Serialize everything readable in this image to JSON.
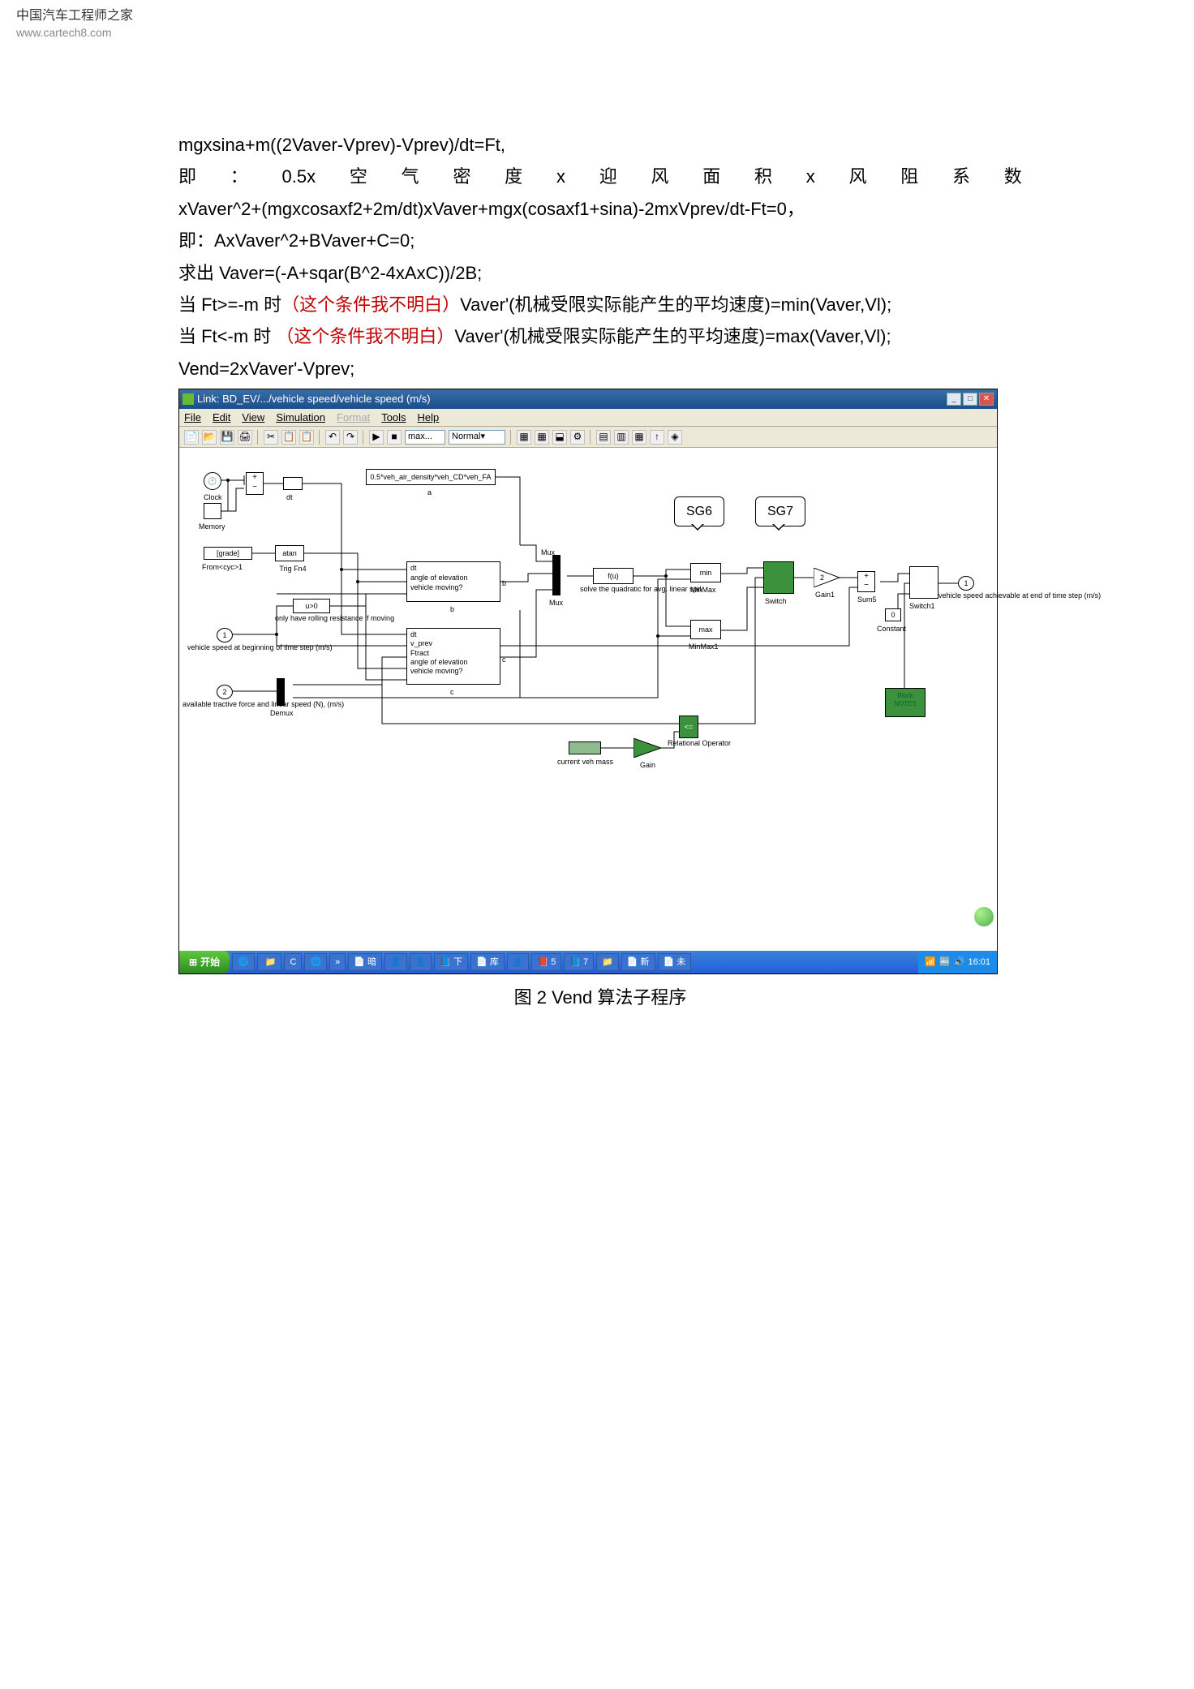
{
  "watermark": {
    "line1": "中国汽车工程师之家",
    "line2": "www.cartech8.com"
  },
  "text": {
    "l1": "mgxsina+m((2Vaver-Vprev)-Vprev)/dt=Ft,",
    "l2_parts": [
      "即",
      "：",
      "0.5x",
      "空",
      "气",
      "密",
      "度",
      "x",
      "迎",
      "风",
      "面",
      "积",
      "x",
      "风",
      "阻",
      "系",
      "数"
    ],
    "l3": "xVaver^2+(mgxcosaxf2+2m/dt)xVaver+mgx(cosaxf1+sina)-2mxVprev/dt-Ft=0，",
    "l4": "即：AxVaver^2+BVaver+C=0;",
    "l5": "求出 Vaver=(-A+sqar(B^2-4xAxC))/2B;",
    "l6a": "当 Ft>=-m 时",
    "l6b": "（这个条件我不明白）",
    "l6c": "Vaver'(机械受限实际能产生的平均速度)=min(Vaver,Vl);",
    "l7a": "当 Ft<-m 时 ",
    "l7b": "（这个条件我不明白）",
    "l7c": "Vaver'(机械受限实际能产生的平均速度)=max(Vaver,Vl);",
    "l8": "Vend=2xVaver'-Vprev;"
  },
  "simulink": {
    "title": "Link: BD_EV/.../vehicle speed/vehicle speed (m/s)",
    "menu": {
      "file": "File",
      "edit": "Edit",
      "view": "View",
      "simulation": "Simulation",
      "format": "Format",
      "tools": "Tools",
      "help": "Help"
    },
    "toolbar": {
      "field1": "max...",
      "field2": "Normal"
    },
    "callouts": {
      "sg6": "SG6",
      "sg7": "SG7"
    },
    "blocks": {
      "clock": "Clock",
      "memory": "Memory",
      "dt": "dt",
      "a_formula": "0.5*veh_air_density*veh_CD*veh_FA",
      "a": "a",
      "grade": "[grade]",
      "from": "From<cyc>1",
      "atan": "atan",
      "trig": "Trig Fn4",
      "u0": "u>0",
      "rolling": "only have rolling resistance if moving",
      "in1": "1",
      "in1_label": "vehicle speed at beginning of time step (m/s)",
      "in2": "2",
      "in2_label": "available tractive force and linear speed (N), (m/s)",
      "demux": "Demux",
      "b_dt": "dt",
      "b_angle": "angle of elevation",
      "b_moving": "vehicle moving?",
      "b": "b",
      "c_dt": "dt",
      "c_vprev": "v_prev",
      "c_ftract": "Ftract",
      "c_angle": "angle of elevation",
      "c_moving": "vehicle moving?",
      "c": "c",
      "mux": "Mux",
      "fu": "f(u)",
      "quad": "solve the quadratic for avg. linear spd",
      "min": "min",
      "minmax": "MinMax",
      "max": "max",
      "minmax1": "MinMax1",
      "switch": "Switch",
      "gain1": "Gain1",
      "sum5": "Sum5",
      "switch1": "Switch1",
      "const0": "0",
      "constant": "Constant",
      "out1": "1",
      "out_label": "vehicle speed achievable at end of time step (m/s)",
      "relop": "<=",
      "relop_label": "Relational Operator",
      "mass": "current veh mass",
      "gain": "Gain",
      "notes": "Block NOTES"
    }
  },
  "taskbar": {
    "start": "开始",
    "items": [
      "",
      "",
      "",
      "",
      "暗",
      "",
      "",
      "下",
      "库",
      "",
      "5",
      "7",
      "",
      "新",
      "未"
    ],
    "time": "16:01"
  },
  "figure_caption": "图 2   Vend 算法子程序"
}
